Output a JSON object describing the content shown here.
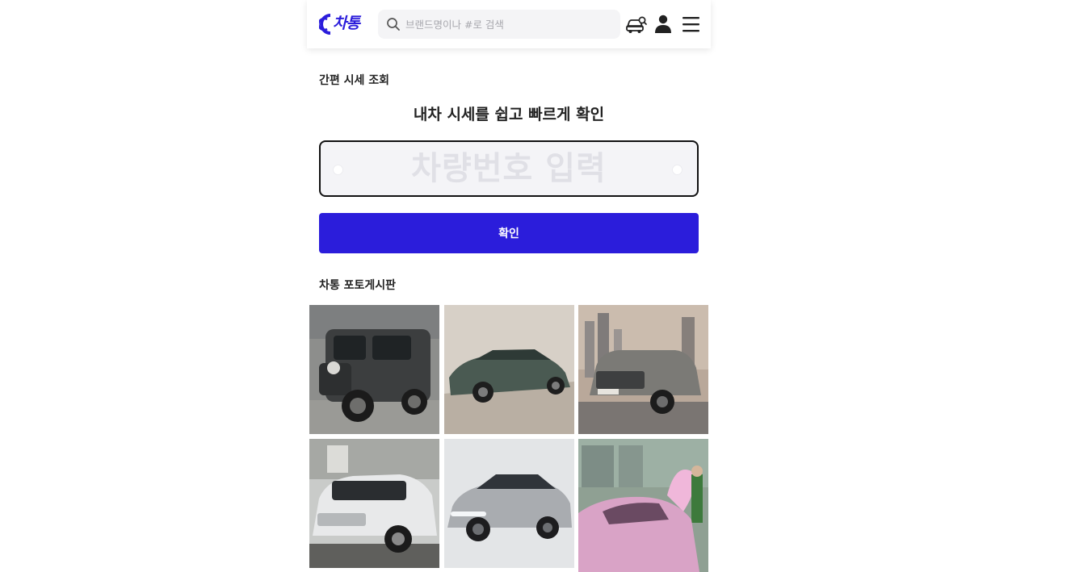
{
  "header": {
    "logo_text": "차통",
    "search_placeholder": "브랜드명이나 #로 검색",
    "icons": [
      "search-icon",
      "car-search-icon",
      "user-icon",
      "menu-icon"
    ]
  },
  "quick_quote": {
    "section_title": "간편 시세 조회",
    "headline": "내차 시세를 쉽고 빠르게 확인",
    "plate_placeholder": "차량번호 입력",
    "confirm_label": "확인"
  },
  "photo_board": {
    "section_title": "차통 포토게시판",
    "photos": [
      {
        "subject": "dark gray boxy compact SUV on concrete",
        "palette": [
          "#8d8e8c",
          "#3c3e3f"
        ]
      },
      {
        "subject": "green compact crossover in studio",
        "palette": [
          "#d7d0c7",
          "#4a5a52"
        ]
      },
      {
        "subject": "gray SUV in front of city skyline",
        "palette": [
          "#b9a89a",
          "#7b7a76"
        ]
      },
      {
        "subject": "white electric SUV outdoors",
        "palette": [
          "#c9cbc9",
          "#e8e9ea"
        ]
      },
      {
        "subject": "silver electric crossover in studio",
        "palette": [
          "#e3e5e7",
          "#a9acb0"
        ]
      },
      {
        "subject": "pink car with person",
        "palette": [
          "#8fa093",
          "#d9a3c6"
        ]
      }
    ]
  },
  "colors": {
    "accent": "#2b1ddb",
    "search_bg": "#f4f4f6",
    "plate_bg": "#f4f4f7"
  }
}
